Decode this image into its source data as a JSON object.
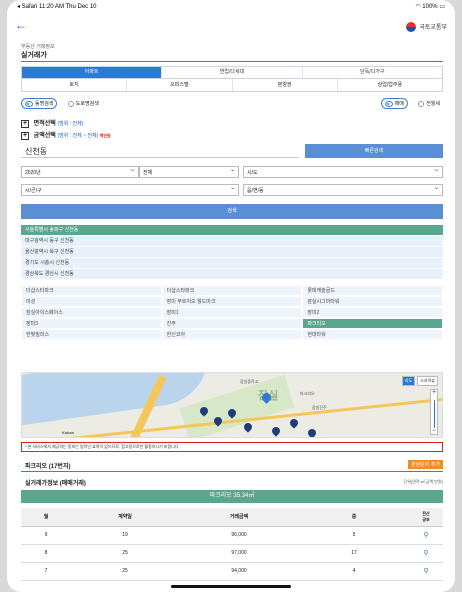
{
  "status_bar": {
    "carrier": "◂ Safari",
    "time": "11:20 AM",
    "date": "Thu Dec 10",
    "battery": "100%"
  },
  "header": {
    "back_icon": "back-arrow-icon",
    "logo_text": "국토교통부"
  },
  "breadcrumb": "부동산 거래정보",
  "page_title": "실거래가",
  "tabs_row1": [
    "아파트",
    "연립/다세대",
    "단독/다가구"
  ],
  "tabs_row2": [
    "토지",
    "오피스텔",
    "분양권",
    "상업/업무용"
  ],
  "active_tab": "아파트",
  "search_type": {
    "option1": "동명검색",
    "option2": "도로명검색"
  },
  "deal_type": {
    "option1": "매매",
    "option2": "전월세"
  },
  "filters": {
    "area_label": "면적선택",
    "area_range_prefix": "(범위 :",
    "area_range": "전체",
    "area_range_suffix": ")",
    "price_label": "금액선택",
    "price_range_prefix": "(범위 :",
    "price_range": "전체 ~ 전체",
    "price_range_suffix": ")",
    "price_unit": "백만원"
  },
  "search": {
    "value": "신천동",
    "quick_button": "빠른검색"
  },
  "selects": {
    "year": "2020년",
    "period": "전체",
    "sido": "시/도",
    "sigungu": "시/군/구",
    "eupmyeondong": "읍/면/동"
  },
  "search_button": "검색",
  "suggestions": [
    "서울특별시 송파구 신천동",
    "대구광역시 동구 신천동",
    "울산광역시 북구 신천동",
    "경기도 시흥시 신천동",
    "경상북도 경산시 신천동"
  ],
  "highlighted_suggestion": 0,
  "apartments": [
    "더샵스타파크",
    "더샵스타파크",
    "롯데캐슬골드",
    "미성",
    "장미 푸르지오 월드마크",
    "잠실시그마타워",
    "잠실아이스페이스",
    "장미1",
    "장미2",
    "장미3",
    "진주",
    "파크리오",
    "한빛빌리스",
    "한신코아",
    "현대타워"
  ],
  "highlighted_apartment": 11,
  "map": {
    "btn_map": "지도",
    "btn_satellite": "스카이뷰",
    "zoom_in": "+",
    "zoom_out": "−",
    "place_label": "잠실",
    "school_label": "잠실중학교",
    "label_a": "파크리오",
    "label_b": "잠실진주",
    "copyright": "Kakao"
  },
  "notice": "* 본 서비스에서 제공하는 정보는 법적인 효력이 없으므로, 참고용으로만 활용하시기 바랍니다.",
  "apartment_title": "파크리오 (17번지)",
  "favorite_button": "관심단지 추가",
  "info_title": "실거래가정보 (매매거래)",
  "unit_note": "단위(면적:㎡,금액:만원)",
  "area_bar": "파크리오 35.34㎡",
  "table": {
    "headers": [
      "월",
      "계약일",
      "거래금액",
      "층",
      "전산\n공부"
    ],
    "rows": [
      [
        "9",
        "19",
        "96,000",
        "5"
      ],
      [
        "8",
        "25",
        "97,000",
        "17"
      ],
      [
        "7",
        "25",
        "94,000",
        "4"
      ]
    ]
  },
  "colors": {
    "accent": "#2b7bd1",
    "highlight": "#5aa78e",
    "favorite": "#f28c1e",
    "notice_border": "#d22222"
  }
}
